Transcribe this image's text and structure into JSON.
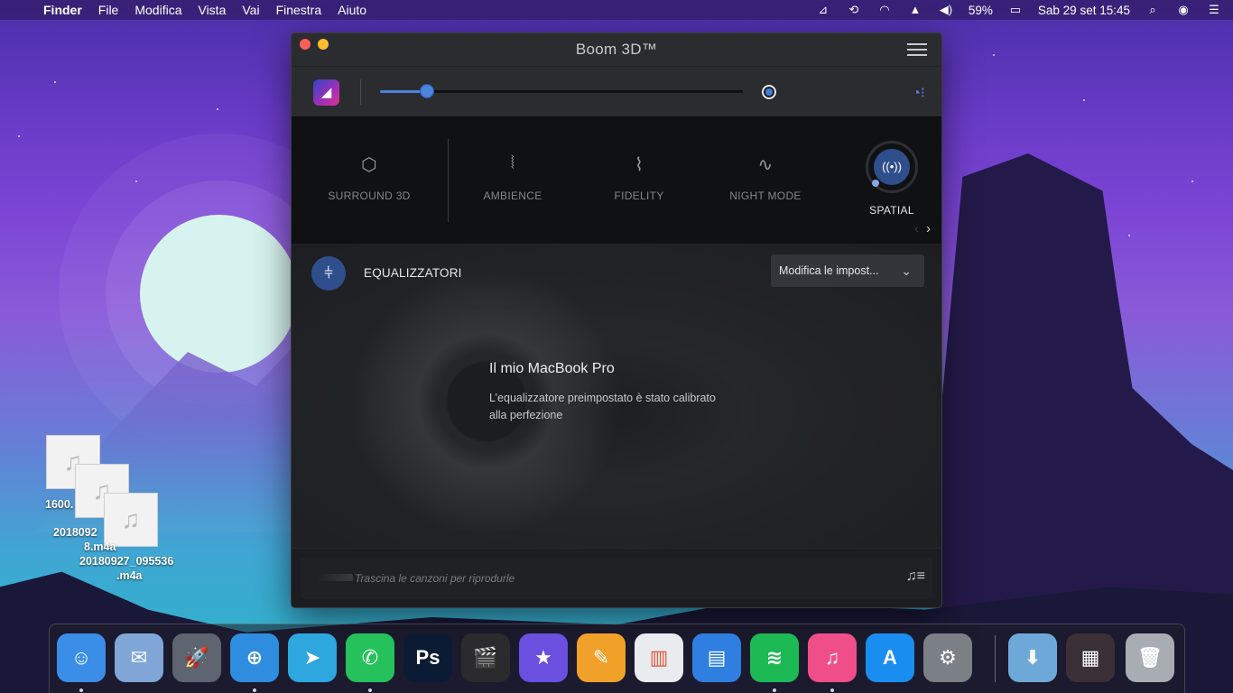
{
  "menubar": {
    "apple": "",
    "app_name": "Finder",
    "menus": [
      "File",
      "Modifica",
      "Vista",
      "Vai",
      "Finestra",
      "Aiuto"
    ],
    "battery": "59%",
    "datetime": "Sab 29 set  15:45"
  },
  "desktop": {
    "files": [
      {
        "label": "1600."
      },
      {
        "label": "2018092"
      },
      {
        "label": "8.m4a"
      },
      {
        "label": "20180927_095536"
      },
      {
        "label": ".m4a"
      }
    ],
    "file_icon": "♫"
  },
  "boom": {
    "title": "Boom 3D™",
    "volume_level": 0.13,
    "effects": [
      {
        "label": "SURROUND 3D",
        "icon": "cube-icon"
      },
      {
        "label": "AMBIENCE",
        "icon": "ambience-icon"
      },
      {
        "label": "FIDELITY",
        "icon": "fidelity-icon"
      },
      {
        "label": "NIGHT MODE",
        "icon": "night-mode-icon"
      }
    ],
    "spatial": {
      "label": "SPATIAL",
      "icon": "speaker-waves-icon"
    },
    "equalizer": {
      "title": "EQUALIZZATORI",
      "preset": "Modifica le impost...",
      "device": "Il mio MacBook Pro",
      "description": "L’equalizzatore preimpostato è stato calibrato alla perfezione"
    },
    "drop_text": "Trascina le canzoni per riprodurle"
  },
  "dock": {
    "apps": [
      {
        "name": "finder",
        "icon": "finder-icon",
        "color": "#3a8ee8",
        "glyph": "☺"
      },
      {
        "name": "mail-stamp",
        "icon": "stamp-icon",
        "color": "#7fa6d6",
        "glyph": "✉"
      },
      {
        "name": "launchpad",
        "icon": "rocket-icon",
        "color": "#5e6470",
        "glyph": "🚀"
      },
      {
        "name": "safari",
        "icon": "compass-icon",
        "color": "#2f8de0",
        "glyph": "⊕"
      },
      {
        "name": "telegram",
        "icon": "paper-plane-icon",
        "color": "#2ea6de",
        "glyph": "➤"
      },
      {
        "name": "whatsapp",
        "icon": "phone-bubble-icon",
        "color": "#25c15a",
        "glyph": "✆"
      },
      {
        "name": "photoshop",
        "icon": "ps-icon",
        "color": "#0b1b33",
        "glyph": "Ps"
      },
      {
        "name": "final-cut",
        "icon": "clapper-icon",
        "color": "#2b2b2e",
        "glyph": "🎬"
      },
      {
        "name": "imovie",
        "icon": "star-icon",
        "color": "#6a4fe0",
        "glyph": "★"
      },
      {
        "name": "pages",
        "icon": "pen-icon",
        "color": "#f0a12a",
        "glyph": "✎"
      },
      {
        "name": "numbers",
        "icon": "bar-chart-icon",
        "color": "#e8ecef",
        "glyph": "▥"
      },
      {
        "name": "keynote",
        "icon": "presentation-icon",
        "color": "#2e7fe0",
        "glyph": "▤"
      },
      {
        "name": "spotify",
        "icon": "spotify-icon",
        "color": "#1db954",
        "glyph": "≋"
      },
      {
        "name": "itunes",
        "icon": "music-note-icon",
        "color": "#f04e89",
        "glyph": "♫"
      },
      {
        "name": "app-store",
        "icon": "app-store-icon",
        "color": "#1a8ef0",
        "glyph": "A"
      },
      {
        "name": "system-preferences",
        "icon": "gear-icon",
        "color": "#7b7f86",
        "glyph": "⚙"
      },
      {
        "name": "downloads",
        "icon": "download-folder-icon",
        "color": "#6ea8d8",
        "glyph": "⬇"
      },
      {
        "name": "photo-stack",
        "icon": "photo-stack-icon",
        "color": "#3a3035",
        "glyph": "▦"
      },
      {
        "name": "trash",
        "icon": "trash-icon",
        "color": "#a8adb3",
        "glyph": "🗑"
      }
    ]
  }
}
